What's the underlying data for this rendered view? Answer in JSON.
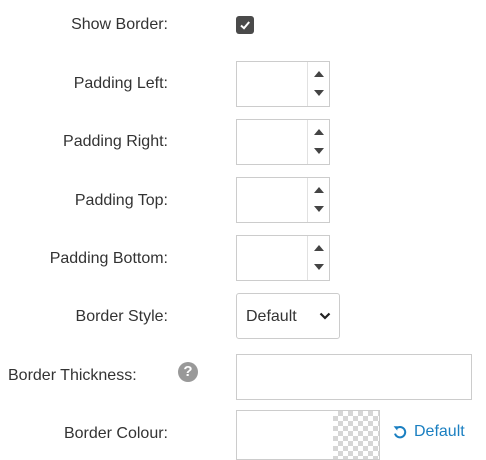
{
  "labels": {
    "show_border": "Show Border:",
    "padding_left": "Padding Left:",
    "padding_right": "Padding Right:",
    "padding_top": "Padding Top:",
    "padding_bottom": "Padding Bottom:",
    "border_style": "Border Style:",
    "border_thickness": "Border Thickness:",
    "border_colour": "Border Colour:"
  },
  "values": {
    "show_border_checked": true,
    "padding_left": "",
    "padding_right": "",
    "padding_top": "",
    "padding_bottom": "",
    "border_thickness": "",
    "border_colour": ""
  },
  "border_style": {
    "selected": "Default"
  },
  "colour_picker": {
    "reset_label": "Default"
  },
  "icons": {
    "check": "check-icon",
    "help": "question-circle-icon",
    "reset": "undo-icon",
    "chevron": "chevron-down-icon"
  },
  "colors": {
    "link": "#1a7fc1",
    "checkbox": "#4a4a4a",
    "border": "#cccccc"
  }
}
